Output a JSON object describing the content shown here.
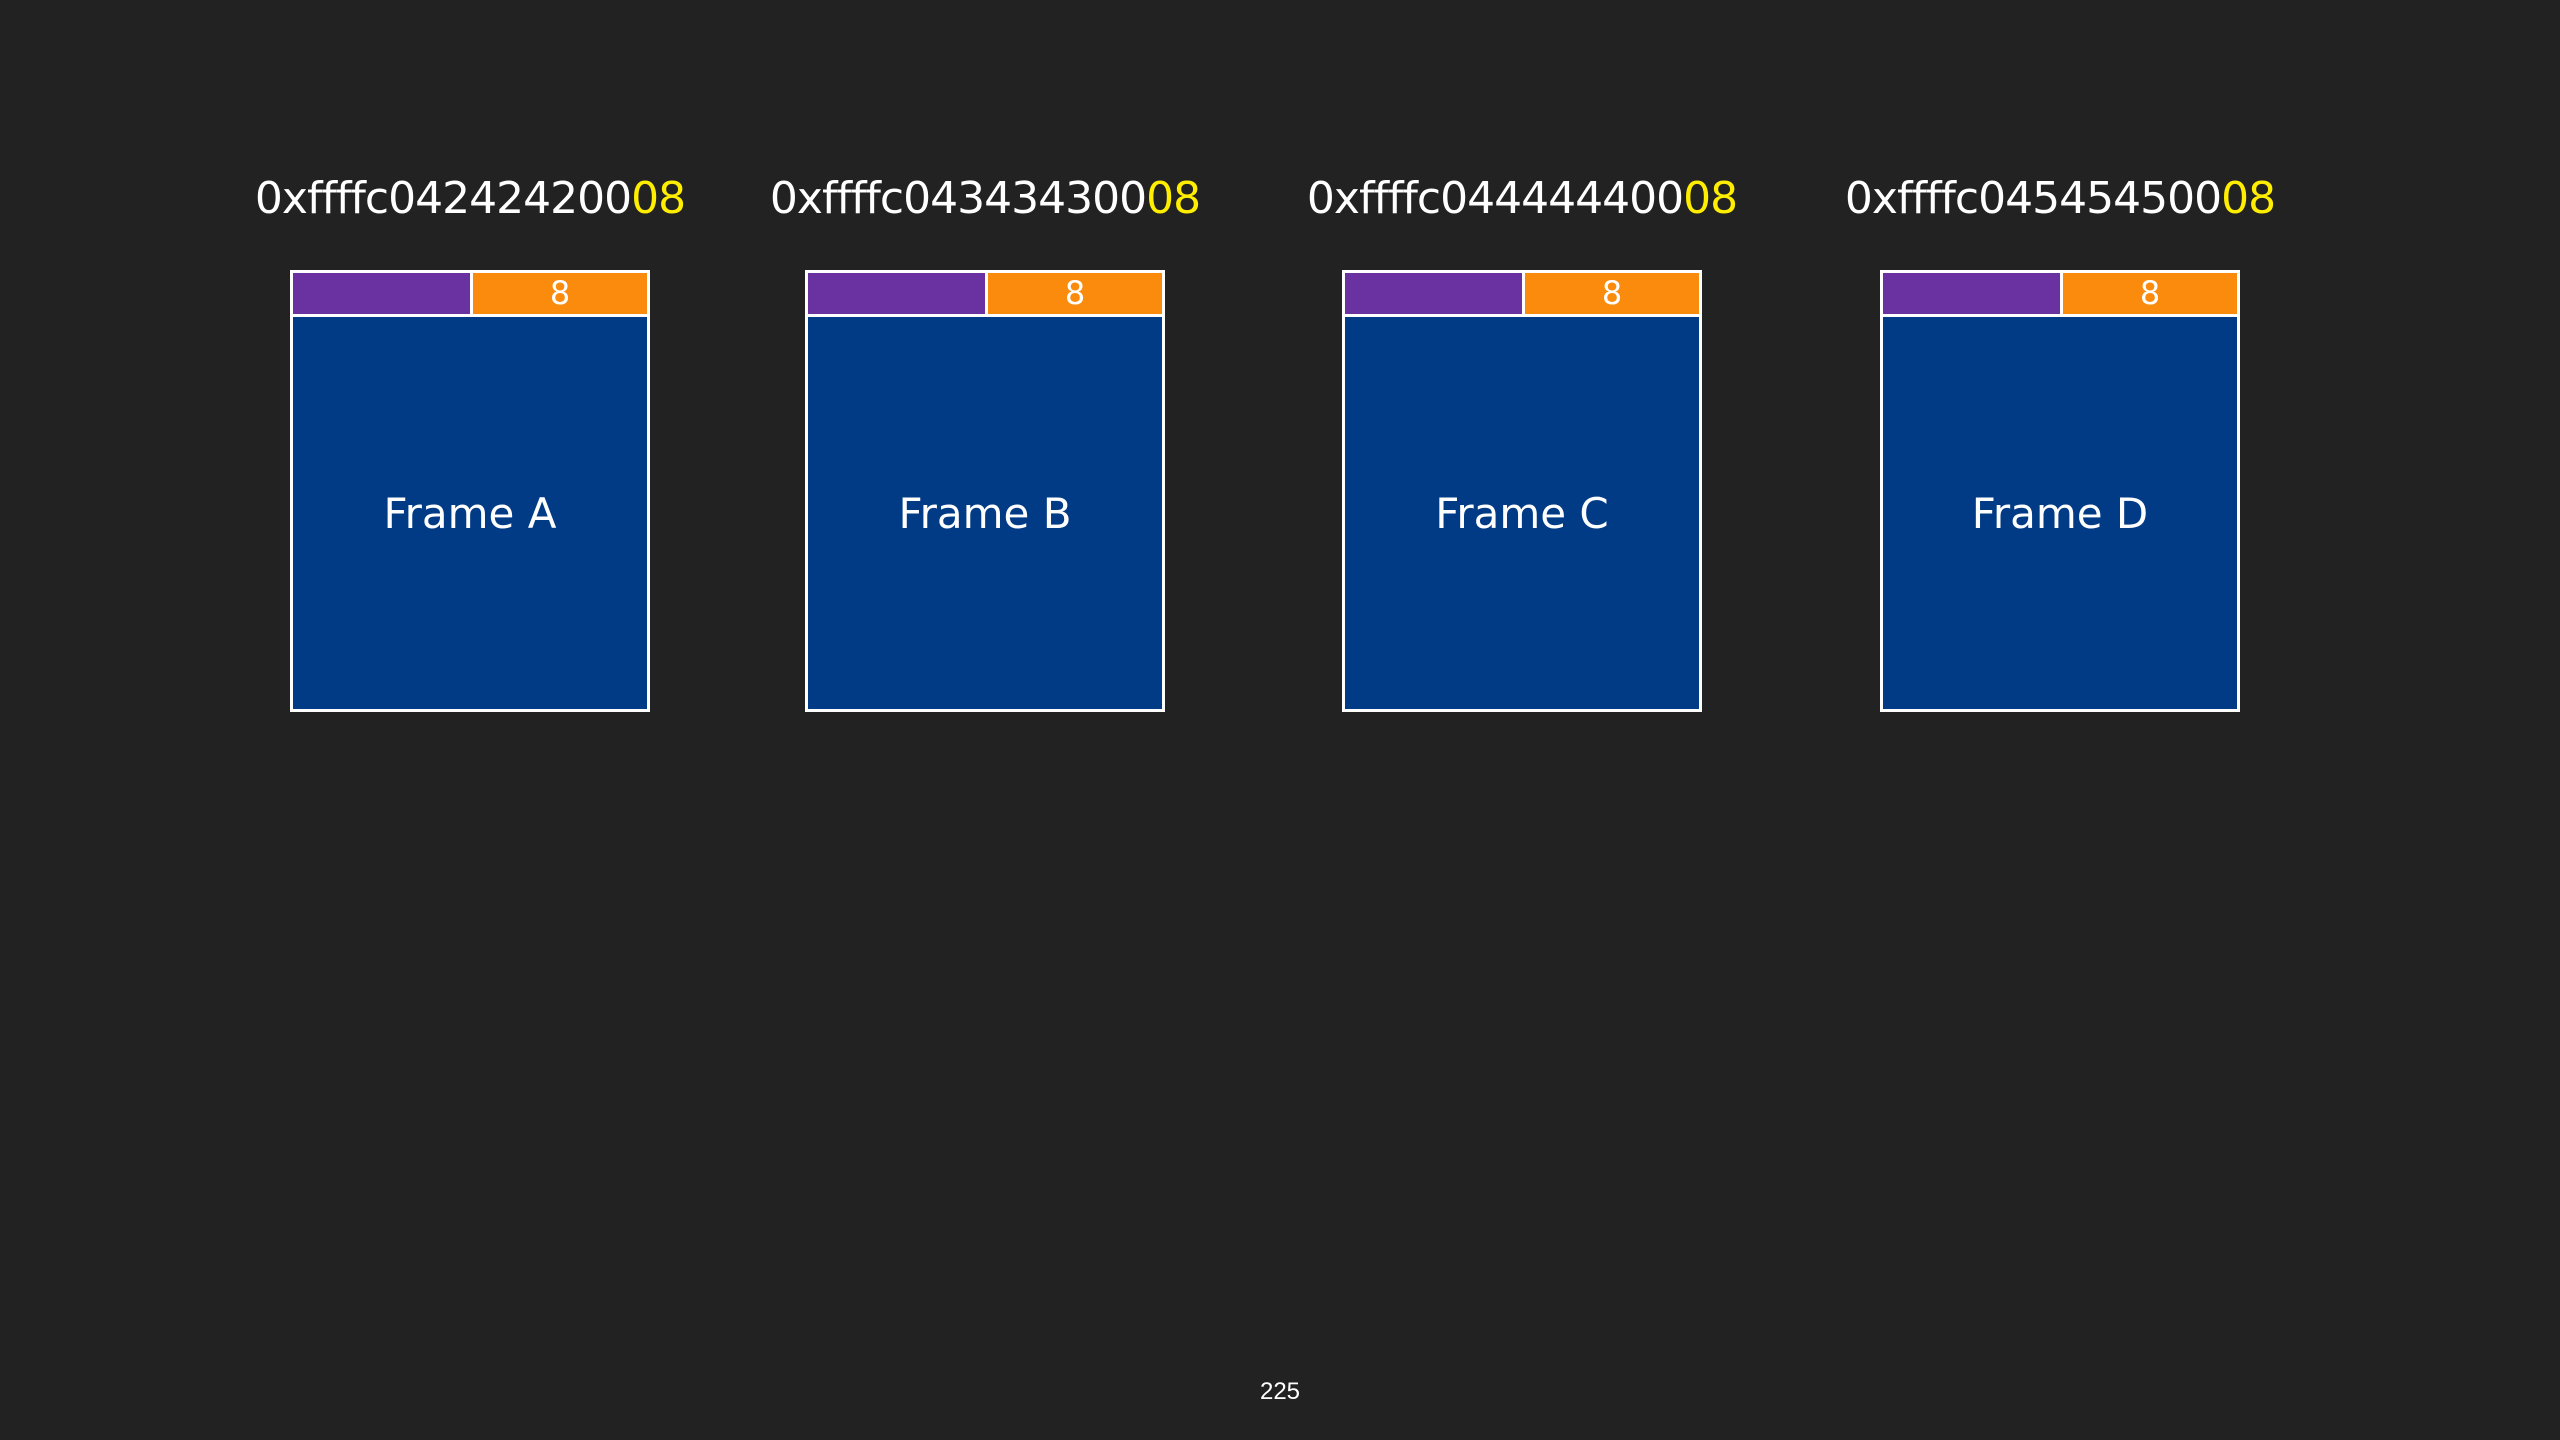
{
  "colors": {
    "background": "#222222",
    "frame_fill": "#013b86",
    "tag_left_fill": "#6a31a0",
    "tag_right_fill": "#fb8b0d",
    "address_highlight": "#ffee00",
    "border": "#ffffff"
  },
  "frames": [
    {
      "address_prefix": "0xffffc042424200",
      "address_suffix": "08",
      "tag_value": "8",
      "label": "Frame A"
    },
    {
      "address_prefix": "0xffffc043434300",
      "address_suffix": "08",
      "tag_value": "8",
      "label": "Frame B"
    },
    {
      "address_prefix": "0xffffc044444400",
      "address_suffix": "08",
      "tag_value": "8",
      "label": "Frame C"
    },
    {
      "address_prefix": "0xffffc045454500",
      "address_suffix": "08",
      "tag_value": "8",
      "label": "Frame D"
    }
  ],
  "page_number": "225"
}
